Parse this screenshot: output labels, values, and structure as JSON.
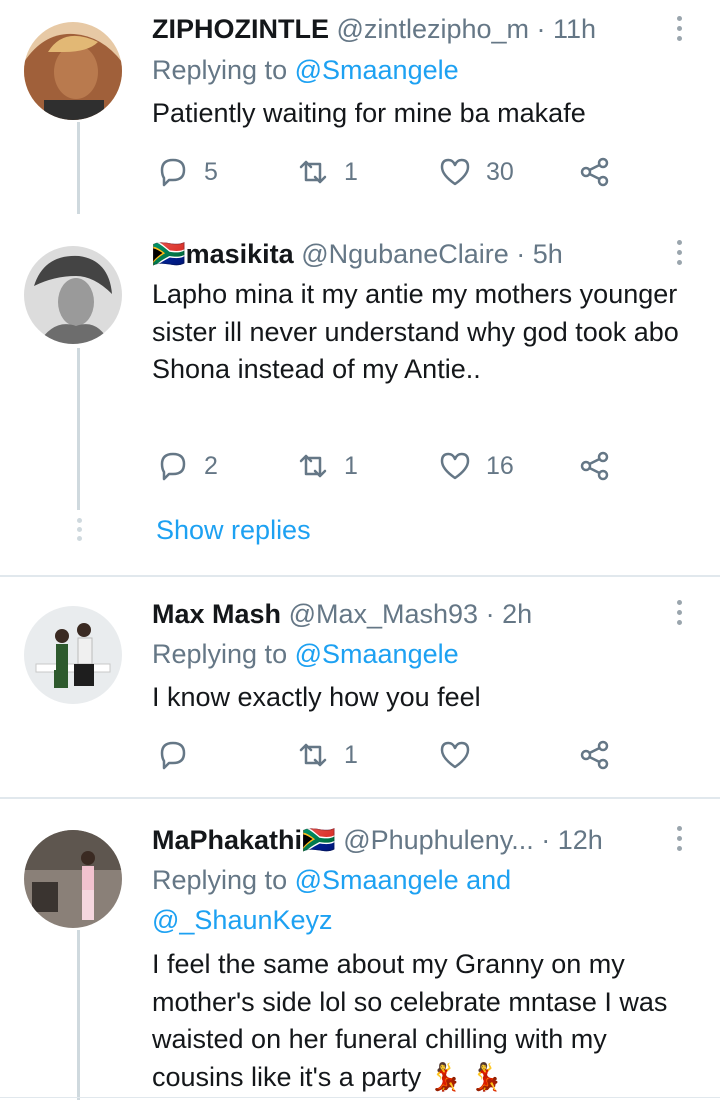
{
  "tweets": [
    {
      "name": "ZIPHOZINTLE",
      "handle": "@zintlezipho_m",
      "time": "· 11h",
      "reply_prefix": "Replying to",
      "reply_users": "@Smaangele",
      "text": "Patiently waiting for mine ba makafe",
      "replies": "5",
      "retweets": "1",
      "likes": "30",
      "avatar_color": "#c88a5a"
    },
    {
      "name_flag": "🇿🇦",
      "name": "masikita",
      "handle": "@NgubaneClaire",
      "time": "· 5h",
      "text": "Lapho mina it my antie my mothers younger sister ill never understand why god took abo Shona instead of my Antie..",
      "replies": "2",
      "retweets": "1",
      "likes": "16",
      "avatar_color": "#9a9a9a"
    },
    {
      "name": "Max Mash",
      "handle": "@Max_Mash93",
      "time": "· 2h",
      "reply_prefix": "Replying to",
      "reply_users": "@Smaangele",
      "text": "I know exactly how you feel",
      "replies": "",
      "retweets": "1",
      "likes": "",
      "avatar_color": "#d8dde0"
    },
    {
      "name": "MaPhakathi",
      "name_flag": "🇿🇦",
      "handle": "@Phuphuleny...",
      "time": "· 12h",
      "reply_prefix": "Replying to",
      "reply_users_1": "@Smaangele and",
      "reply_users_2": "@_ShaunKeyz",
      "text": "I feel the same about my Granny on my mother's side lol so celebrate mntase I was waisted on her funeral chilling with my cousins like it's a party 💃 💃",
      "avatar_color": "#7a6e66"
    }
  ],
  "show_replies": "Show replies",
  "colors": {
    "link": "#1da1f2",
    "muted": "#657786",
    "text": "#14171a",
    "divider": "#e1e8ed"
  },
  "icons": [
    "reply-icon",
    "retweet-icon",
    "like-icon",
    "share-icon",
    "more-icon"
  ]
}
